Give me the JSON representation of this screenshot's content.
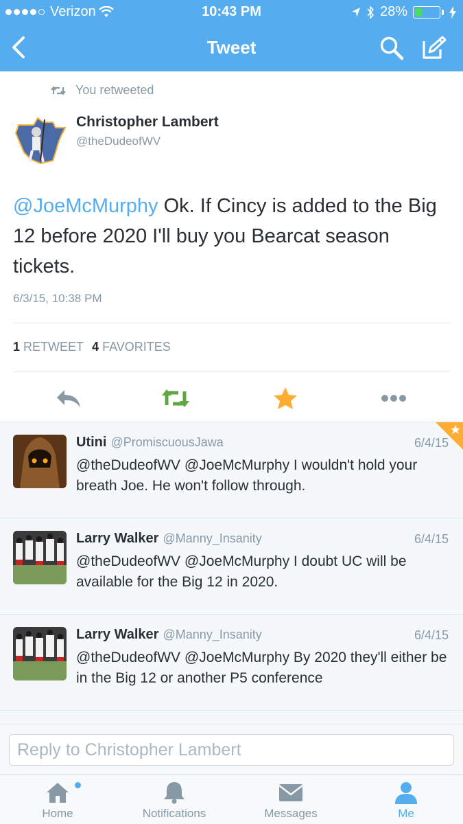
{
  "status_bar": {
    "carrier": "Verizon",
    "time": "10:43 PM",
    "battery": "28%",
    "battery_level": 0.28
  },
  "nav": {
    "title": "Tweet",
    "icons": [
      "back-chevron-icon",
      "search-icon",
      "compose-icon"
    ]
  },
  "tweet": {
    "retweet_label": "You retweeted",
    "author_name": "Christopher Lambert",
    "author_handle": "@theDudeofWV",
    "mention": "@JoeMcMurphy",
    "text": " Ok. If Cincy is added to the Big 12 before 2020 I'll buy you Bearcat season tickets.",
    "timestamp": "6/3/15, 10:38 PM",
    "retweet_count": "1",
    "retweet_label_stat": "RETWEET",
    "favorite_count": "4",
    "favorite_label_stat": "FAVORITES",
    "actions": [
      "reply-icon",
      "retweet-icon",
      "favorite-icon",
      "more-icon"
    ],
    "colors": {
      "retweeted": "#5fa744",
      "favorited": "#ffac33"
    }
  },
  "replies": [
    {
      "name": "Utini",
      "handle": "@PromiscuousJawa",
      "date": "6/4/15",
      "text": "@theDudeofWV @JoeMcMurphy I wouldn't hold your breath Joe. He won't follow through."
    },
    {
      "name": "Larry Walker",
      "handle": "@Manny_Insanity",
      "date": "6/4/15",
      "text": "@theDudeofWV @JoeMcMurphy I doubt UC will be available for the Big 12 in 2020."
    },
    {
      "name": "Larry Walker",
      "handle": "@Manny_Insanity",
      "date": "6/4/15",
      "text": "@theDudeofWV @JoeMcMurphy By 2020 they'll either be in the Big 12 or another P5 conference"
    }
  ],
  "reply_bar": {
    "placeholder": "Reply to Christopher Lambert"
  },
  "tabs": [
    {
      "label": "Home"
    },
    {
      "label": "Notifications"
    },
    {
      "label": "Messages"
    },
    {
      "label": "Me"
    }
  ],
  "colors": {
    "brand": "#55acee",
    "text": "#292f33",
    "muted": "#8899a6"
  }
}
